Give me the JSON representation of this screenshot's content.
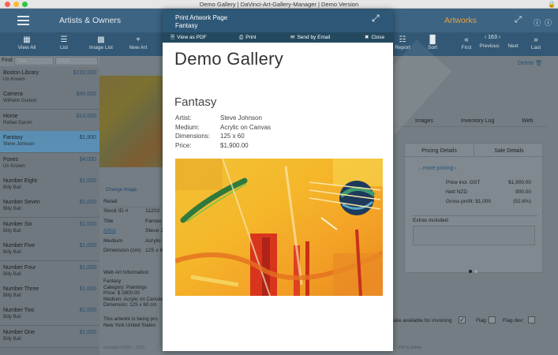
{
  "window": {
    "title": "Demo Gallery | DaVinci-Art-Gallery-Manager | Demo Version"
  },
  "header": {
    "left_title": "Artists & Owners",
    "right_title": "Artworks",
    "right_title_color": "#e8a23a"
  },
  "toolbar": {
    "left": [
      {
        "label": "View All",
        "icon": "view-all-icon"
      },
      {
        "label": "List",
        "icon": "list-icon"
      },
      {
        "label": "Image List",
        "icon": "image-list-icon"
      },
      {
        "label": "New Art",
        "icon": "plus-icon"
      }
    ],
    "right": [
      {
        "label": "Report",
        "icon": "report-icon"
      },
      {
        "label": "Sort",
        "icon": "sort-icon"
      },
      {
        "label": "First",
        "icon": "first-icon"
      },
      {
        "label": "Previous",
        "icon": "previous-icon"
      },
      {
        "label": "Next",
        "icon": "next-icon"
      },
      {
        "label": "Last",
        "icon": "last-icon"
      }
    ],
    "record_number": "163"
  },
  "sidebar": {
    "find_label": "Find",
    "title_placeholder": "Title",
    "artist_placeholder": "Artist",
    "items": [
      {
        "title": "Boston Library",
        "owner": "Un Known",
        "price": "$120,000"
      },
      {
        "title": "Camera",
        "owner": "Wilhelm Gunkel",
        "price": "$40,000"
      },
      {
        "title": "Horse",
        "owner": "Rafael Garcin",
        "price": "$14,000"
      },
      {
        "title": "Fantasy",
        "owner": "Steve Johnson",
        "price": "$1,900"
      },
      {
        "title": "Foxes",
        "owner": "Un Known",
        "price": "$4,000"
      },
      {
        "title": "Number Eight",
        "owner": "Billy Ball",
        "price": "$1,000"
      },
      {
        "title": "Number Seven",
        "owner": "Billy Ball",
        "price": "$1,000"
      },
      {
        "title": "Number Six",
        "owner": "Billy Ball",
        "price": "$1,000"
      },
      {
        "title": "Number Five",
        "owner": "Billy Ball",
        "price": "$1,000"
      },
      {
        "title": "Number Four",
        "owner": "Billy Ball",
        "price": "$1,000"
      },
      {
        "title": "Number Three",
        "owner": "Billy Ball",
        "price": "$1,000"
      },
      {
        "title": "Number Two",
        "owner": "Billy Ball",
        "price": "$1,000"
      },
      {
        "title": "Number One",
        "owner": "Billy Ball",
        "price": "$1,000"
      }
    ],
    "selected_index": 3
  },
  "main": {
    "delete_label": "Delete",
    "change_image": "Change Image",
    "retail_label": "Retail",
    "fields": [
      {
        "label": "Stock ID #",
        "value": "11202"
      },
      {
        "label": "Title",
        "value": "Fantas"
      },
      {
        "label": "Artist",
        "value": "Steve J"
      },
      {
        "label": "Medium",
        "value": "Acrylic"
      },
      {
        "label": "Dimension (cm)",
        "value": "125 x 6"
      }
    ],
    "web_info_label": "Web Art Information",
    "web_info_lines": [
      "Fantasy",
      "Category: Paintings",
      "Price: $ 1800.00",
      "Medium: Acrylic on Canvas",
      "Dimension: 125 x 60 cm"
    ],
    "web_note": "This artwork is being pro",
    "web_note2": "New York United States",
    "footer_left": "ct product 2024 ... 2021",
    "footer_right": "PM by Admin",
    "tabs": [
      "Images",
      "Inventory Log",
      "Web"
    ],
    "pricing_tabs": [
      "Pricing Details",
      "Sale Details"
    ],
    "more_pricing": "...more pricing",
    "price_rows": [
      {
        "label": "Price incl. GST",
        "value": "$1,900.00"
      },
      {
        "label": "Nett NZD",
        "value": "900.00"
      },
      {
        "label": "Gross profit: $1,000",
        "value": "(52.6%)"
      }
    ],
    "extras_label": "Extras included:",
    "invoicing_label": "ake available for invoicing",
    "flag_label": "Flag:",
    "flag_dev_label": "Flag dev:"
  },
  "overlay": {
    "title_line1": "Print Artwork Page",
    "title_line2": "Fantasy",
    "buttons": {
      "pdf": "View as PDF",
      "print": "Print",
      "email": "Send by Email",
      "close": "Close"
    },
    "gallery_name": "Demo Gallery",
    "artwork_title": "Fantasy",
    "details": [
      {
        "label": "Artist:",
        "value": "Steve Johnson"
      },
      {
        "label": "Medium:",
        "value": "Acrylic on Canvas"
      },
      {
        "label": "Dimensions:",
        "value": "125 x 60"
      },
      {
        "label": "Price:",
        "value": "$1,900.00"
      }
    ]
  }
}
